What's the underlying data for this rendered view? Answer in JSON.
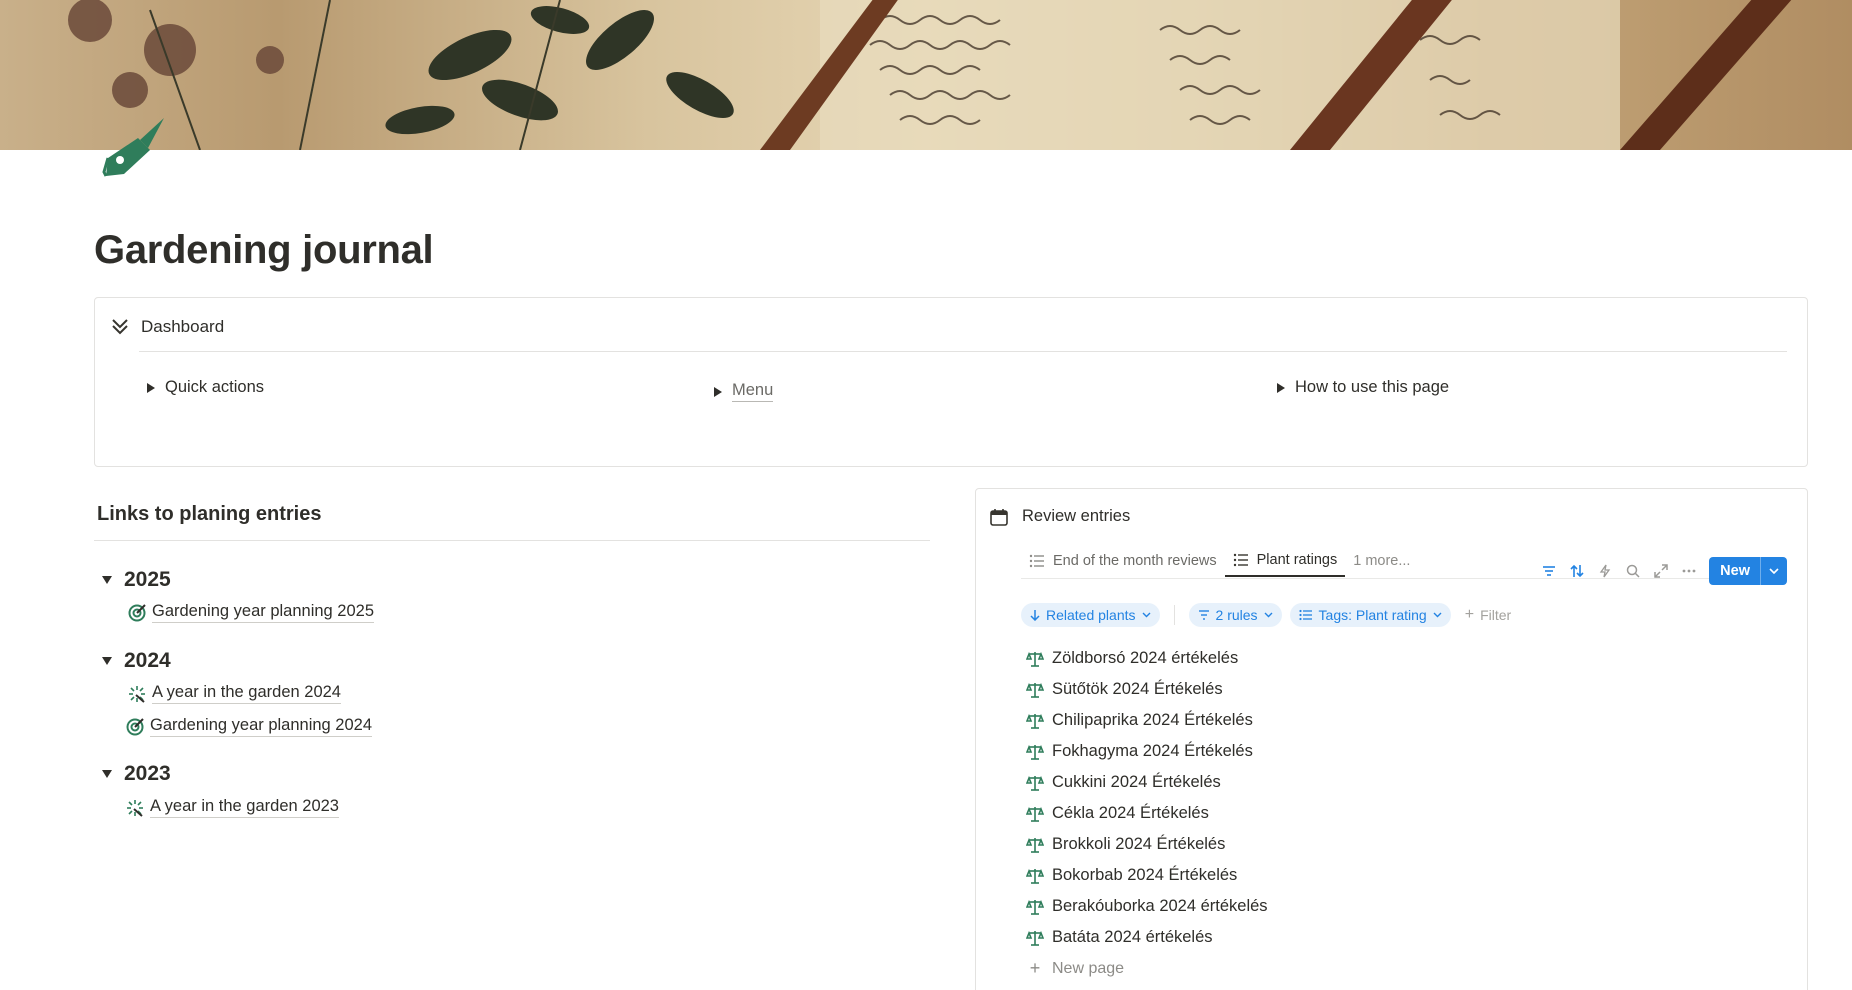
{
  "page": {
    "title": "Gardening journal",
    "icon": "fountain-pen-icon"
  },
  "dashboard": {
    "title": "Dashboard",
    "toggles": [
      "Quick actions",
      "Menu",
      "How to use this page"
    ]
  },
  "planning": {
    "heading": "Links to planing entries",
    "years": [
      {
        "year": "2025",
        "entries": [
          "Gardening year planning 2025"
        ]
      },
      {
        "year": "2024",
        "entries": [
          "A year in the garden 2024",
          "Gardening year planning 2024"
        ]
      },
      {
        "year": "2023",
        "entries": [
          "A year in the garden 2023"
        ]
      }
    ]
  },
  "review": {
    "title": "Review entries",
    "views": [
      "End of the month reviews",
      "Plant ratings"
    ],
    "more_views": "1 more...",
    "new_button": "New",
    "filters": {
      "sort": "Related plants",
      "rules": "2 rules",
      "tags": "Tags: Plant rating",
      "add_filter": "Filter"
    },
    "rows": [
      "Zöldborsó 2024 értékelés",
      "Sütőtök 2024 Értékelés",
      "Chilipaprika 2024 Értékelés",
      "Fokhagyma 2024 Értékelés",
      "Cukkini 2024 Értékelés",
      "Cékla 2024 Értékelés",
      "Brokkoli 2024 Értékelés",
      "Bokorbab 2024 Értékelés",
      "Berakóuborka 2024 értékelés",
      "Batáta 2024 értékelés"
    ],
    "new_page": "New page"
  },
  "colors": {
    "accent_blue": "#2383e2",
    "icon_green": "#2f7d5b",
    "text": "#2f2e2a"
  }
}
